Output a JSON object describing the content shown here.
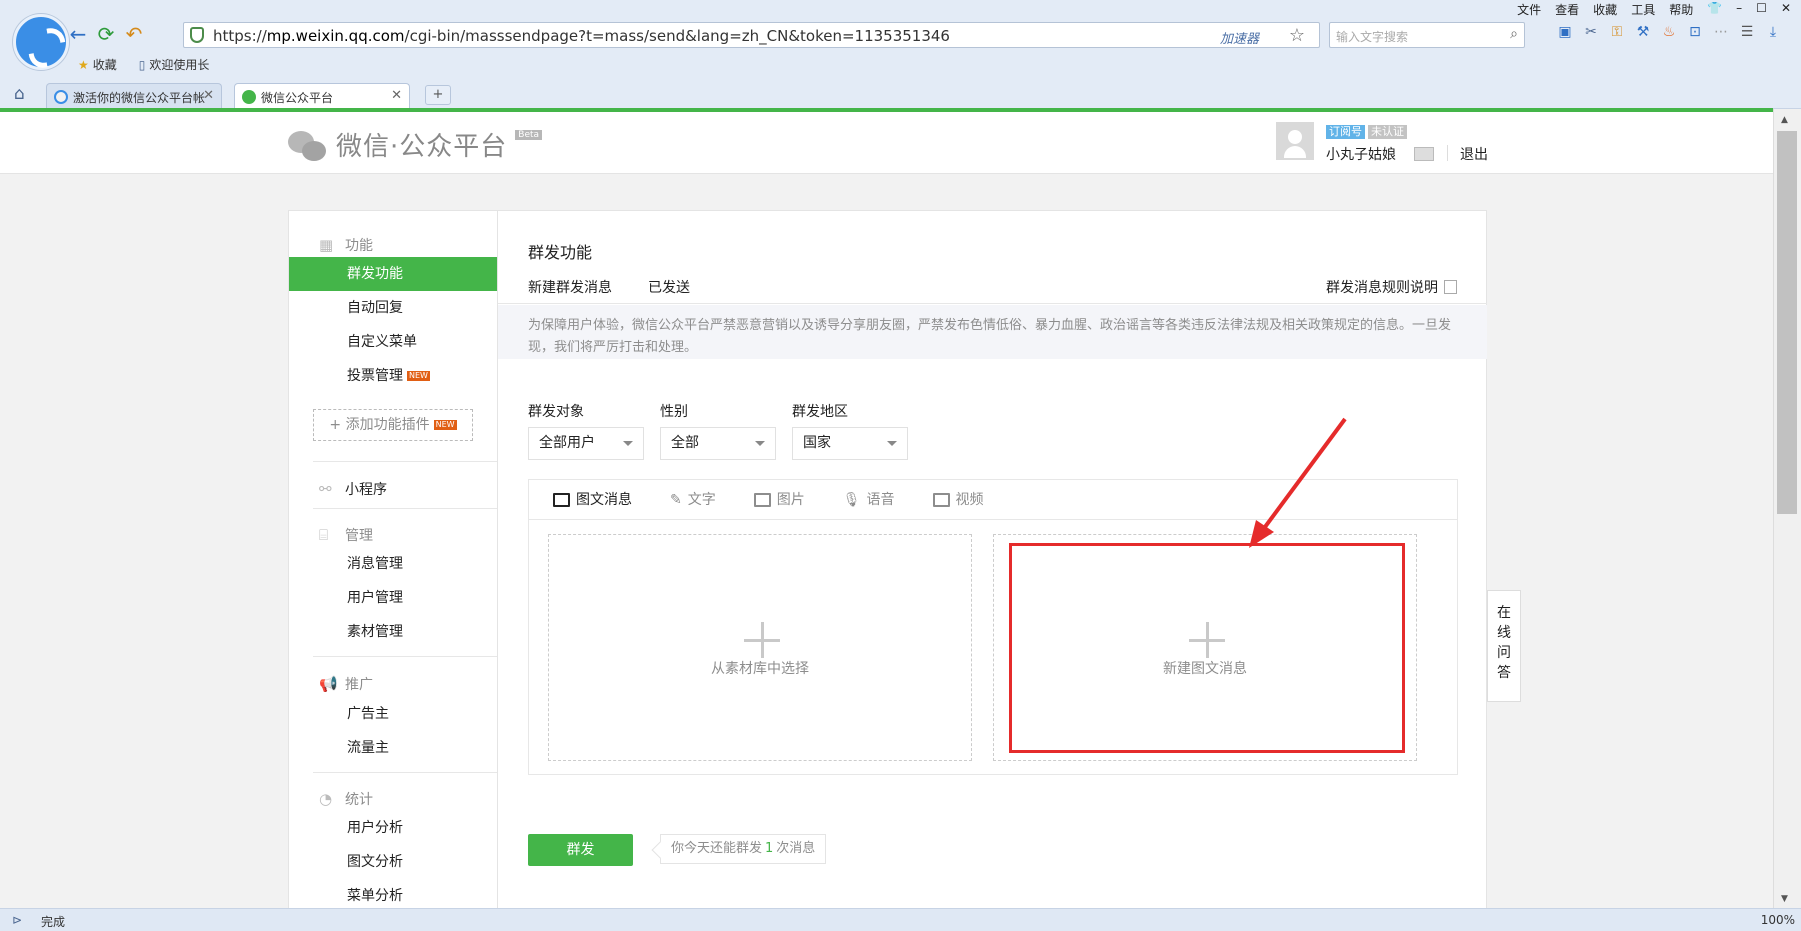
{
  "browser": {
    "menu": [
      "文件",
      "查看",
      "收藏",
      "工具",
      "帮助"
    ],
    "url_prefix": "https://",
    "url_host": "mp.weixin.qq.com",
    "url_path": "/cgi-bin/masssendpage?t=mass/send&lang=zh_CN&token=1135351346",
    "accelerator_label": "加速器",
    "search_placeholder": "输入文字搜索",
    "bookmarks": [
      "收藏",
      "欢迎使用长"
    ],
    "tabs": [
      {
        "title": "激活你的微信公众平台帐",
        "active": false
      },
      {
        "title": "微信公众平台",
        "active": true
      }
    ],
    "new_tab": "+",
    "status_text": "完成",
    "zoom": "100%"
  },
  "header": {
    "logo_text": "微信·公众平台",
    "beta": "Beta",
    "badge_type": "订阅号",
    "badge_verify": "未认证",
    "username": "小丸子姑娘",
    "logout": "退出"
  },
  "sidebar": {
    "sections": [
      {
        "title": "功能",
        "icon": "grid-icon",
        "items": [
          {
            "label": "群发功能",
            "active": true
          },
          {
            "label": "自动回复"
          },
          {
            "label": "自定义菜单"
          },
          {
            "label": "投票管理",
            "new": "NEW"
          }
        ]
      },
      {
        "title": "小程序",
        "icon": "link-icon",
        "items": []
      },
      {
        "title": "管理",
        "icon": "inbox-icon",
        "items": [
          {
            "label": "消息管理"
          },
          {
            "label": "用户管理"
          },
          {
            "label": "素材管理"
          }
        ]
      },
      {
        "title": "推广",
        "icon": "megaphone-icon",
        "items": [
          {
            "label": "广告主"
          },
          {
            "label": "流量主"
          }
        ]
      },
      {
        "title": "统计",
        "icon": "pie-icon",
        "items": [
          {
            "label": "用户分析"
          },
          {
            "label": "图文分析"
          },
          {
            "label": "菜单分析"
          }
        ]
      }
    ],
    "add_plugin": "添加功能插件",
    "add_plugin_new": "NEW"
  },
  "main": {
    "title": "群发功能",
    "tabs": [
      "新建群发消息",
      "已发送"
    ],
    "rules_link": "群发消息规则说明",
    "notice": "为保障用户体验，微信公众平台严禁恶意营销以及诱导分享朋友圈，严禁发布色情低俗、暴力血腥、政治谣言等各类违反法律法规及相关政策规定的信息。一旦发现，我们将严厉打击和处理。",
    "filters": [
      {
        "label": "群发对象",
        "value": "全部用户"
      },
      {
        "label": "性别",
        "value": "全部"
      },
      {
        "label": "群发地区",
        "value": "国家"
      }
    ],
    "editor_tabs": [
      "图文消息",
      "文字",
      "图片",
      "语音",
      "视频"
    ],
    "choose_from_library": "从素材库中选择",
    "new_article": "新建图文消息",
    "send_button": "群发",
    "send_tip_prefix": "你今天还能群发",
    "send_tip_count": "1",
    "send_tip_suffix": "次消息",
    "online_qa": "在线问答"
  },
  "colors": {
    "accent": "#44b549",
    "highlight": "#e52b2b"
  }
}
